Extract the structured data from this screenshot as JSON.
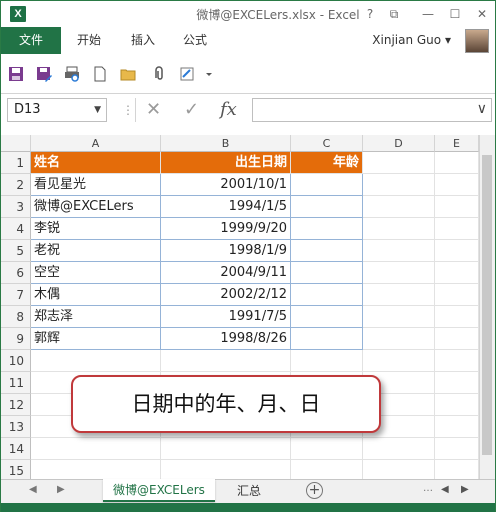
{
  "window": {
    "title": "微博@EXCELers.xlsx - Excel",
    "help": "?",
    "ribbon_display": "⧉",
    "minimize": "—",
    "maximize": "☐",
    "close": "✕",
    "logo": "X"
  },
  "ribbon": {
    "file_tab": "文件",
    "tabs": [
      "开始",
      "插入",
      "公式"
    ],
    "user": "Xinjian Guo",
    "user_caret": "▾"
  },
  "formula_bar": {
    "name_box": "D13",
    "name_arrow": "▼",
    "cancel": "✕",
    "enter": "✓",
    "fx": "fx",
    "formula": "",
    "expand": "∨"
  },
  "columns": [
    "A",
    "B",
    "C",
    "D",
    "E"
  ],
  "rows": [
    "1",
    "2",
    "3",
    "4",
    "5",
    "6",
    "7",
    "8",
    "9",
    "10",
    "11",
    "12",
    "13",
    "14",
    "15"
  ],
  "table": {
    "headers": [
      "姓名",
      "出生日期",
      "年龄"
    ],
    "records": [
      [
        "看见星光",
        "2001/10/1",
        ""
      ],
      [
        "微博@EXCELers",
        "1994/1/5",
        ""
      ],
      [
        "李锐",
        "1999/9/20",
        ""
      ],
      [
        "老祝",
        "1998/1/9",
        ""
      ],
      [
        "空空",
        "2004/9/11",
        ""
      ],
      [
        "木偶",
        "2002/2/12",
        ""
      ],
      [
        "郑志泽",
        "1991/7/5",
        ""
      ],
      [
        "郭辉",
        "1998/8/26",
        ""
      ]
    ]
  },
  "callout": "日期中的年、月、日",
  "sheets": {
    "active": "微博@EXCELers",
    "other": "汇总",
    "add": "+",
    "prev": "◀",
    "next": "▶",
    "more": "…"
  },
  "colors": {
    "accent": "#217346",
    "header_fill": "#e46c0a",
    "callout_border": "#c0393b"
  },
  "icons": [
    "save-icon",
    "save-as-icon",
    "print-preview-icon",
    "new-doc-icon",
    "open-folder-icon",
    "attach-icon",
    "format-icon",
    "qat-dropdown-icon"
  ]
}
